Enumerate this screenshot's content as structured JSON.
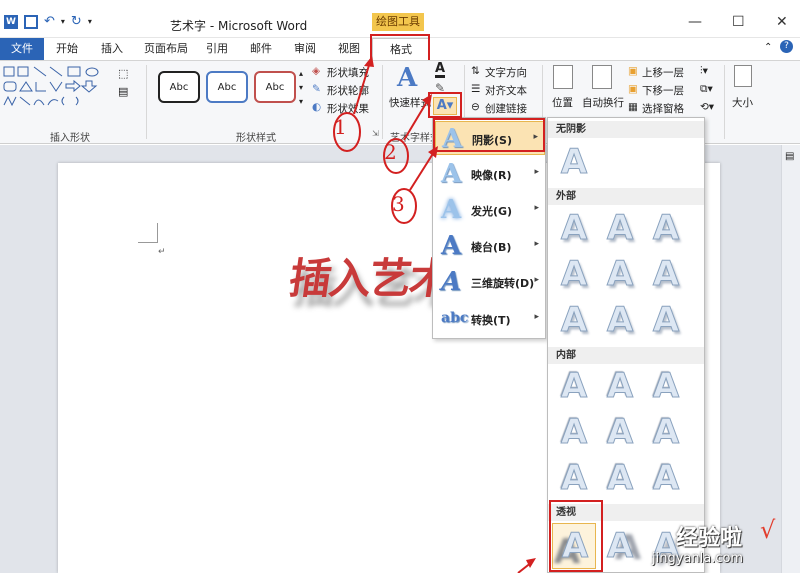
{
  "window": {
    "title": "艺术字 - Microsoft Word",
    "contextual_tab_group": "绘图工具",
    "min_glyph": "—",
    "max_glyph": "☐",
    "close_glyph": "✕"
  },
  "tabs": [
    "文件",
    "开始",
    "插入",
    "页面布局",
    "引用",
    "邮件",
    "审阅",
    "视图",
    "格式"
  ],
  "ribbon": {
    "groups": {
      "insert_shapes": "插入形状",
      "shape_styles": "形状样式",
      "wordart_styles": "艺术字样式"
    },
    "shape_style_samples": [
      "Abc",
      "Abc",
      "Abc"
    ],
    "shape_commands": [
      "形状填充",
      "形状轮廓",
      "形状效果"
    ],
    "quick_styles": "快速样式",
    "text_commands": [
      "文字方向",
      "对齐文本",
      "创建链接"
    ],
    "arrange": {
      "position": "位置",
      "wrap": "自动换行",
      "bring_forward": "上移一层",
      "send_backward": "下移一层",
      "selection_pane": "选择窗格"
    },
    "size": "大小"
  },
  "document": {
    "wordart_text": "插入艺术"
  },
  "effects_menu": {
    "items": [
      {
        "label": "阴影(S)",
        "highlighted": true
      },
      {
        "label": "映像(R)"
      },
      {
        "label": "发光(G)"
      },
      {
        "label": "棱台(B)"
      },
      {
        "label": "三维旋转(D)"
      },
      {
        "label": "转换(T)"
      }
    ]
  },
  "shadow_gallery": {
    "sections": [
      "无阴影",
      "外部",
      "内部",
      "透视"
    ],
    "glyph": "A"
  },
  "annotations": [
    "1",
    "2",
    "3"
  ],
  "watermark": {
    "brand": "经验啦",
    "url": "jingyanla.com",
    "check": "√"
  },
  "colors": {
    "file_tab": "#2b64b6",
    "contextual": "#f3c64d",
    "highlight": "#fbe3b3",
    "annotation_red": "#d32020"
  }
}
